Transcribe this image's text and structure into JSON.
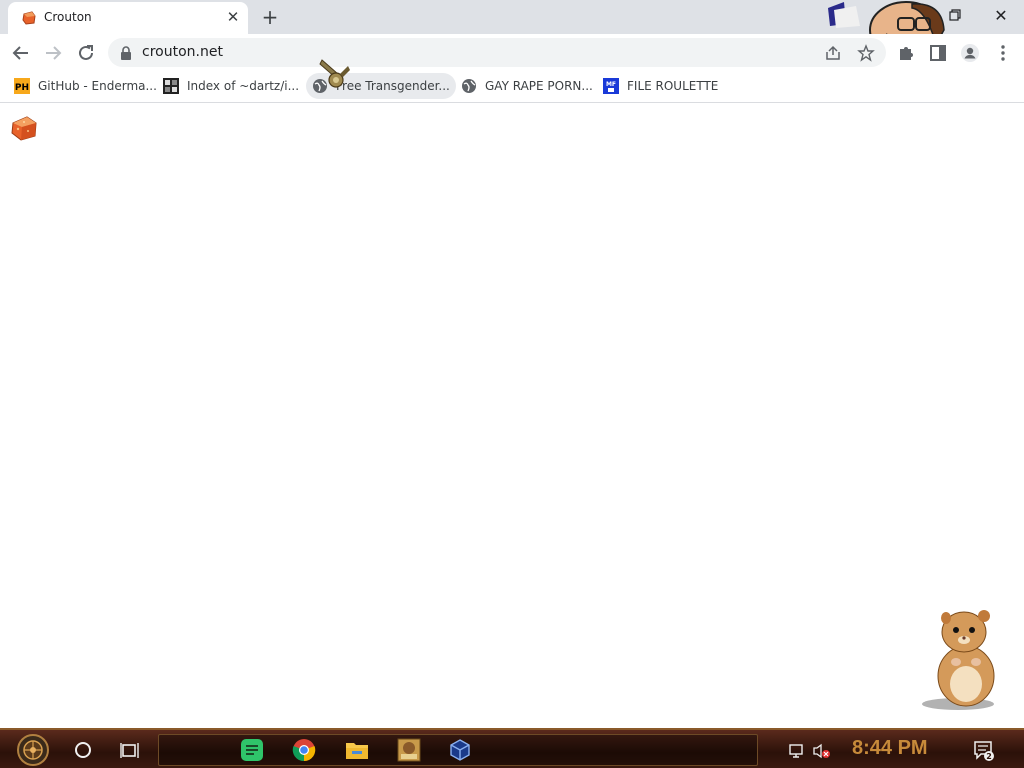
{
  "tab": {
    "title": "Crouton",
    "close_glyph": "✕",
    "new_tab_glyph": "+"
  },
  "window": {
    "close_glyph": "✕"
  },
  "toolbar": {
    "url": "crouton.net"
  },
  "bookmarks": [
    {
      "label": "GitHub - Enderma...",
      "icon": "ph-icon"
    },
    {
      "label": "Index of ~dartz/i...",
      "icon": "image-icon"
    },
    {
      "label": "Free Transgender...",
      "icon": "globe-icon"
    },
    {
      "label": "GAY RAPE PORN...",
      "icon": "globe-icon"
    },
    {
      "label": "FILE ROULETTE",
      "icon": "mf-icon"
    }
  ],
  "bookmark_icon_text": {
    "ph": "PH",
    "mf": "MF"
  },
  "taskbar": {
    "clock": "8:44 PM",
    "notification_count": "2",
    "accent": "#c78a3a"
  },
  "colors": {
    "tabstrip": "#dee1e6",
    "omnibox": "#f1f3f4",
    "crouton": "#e8622a"
  }
}
